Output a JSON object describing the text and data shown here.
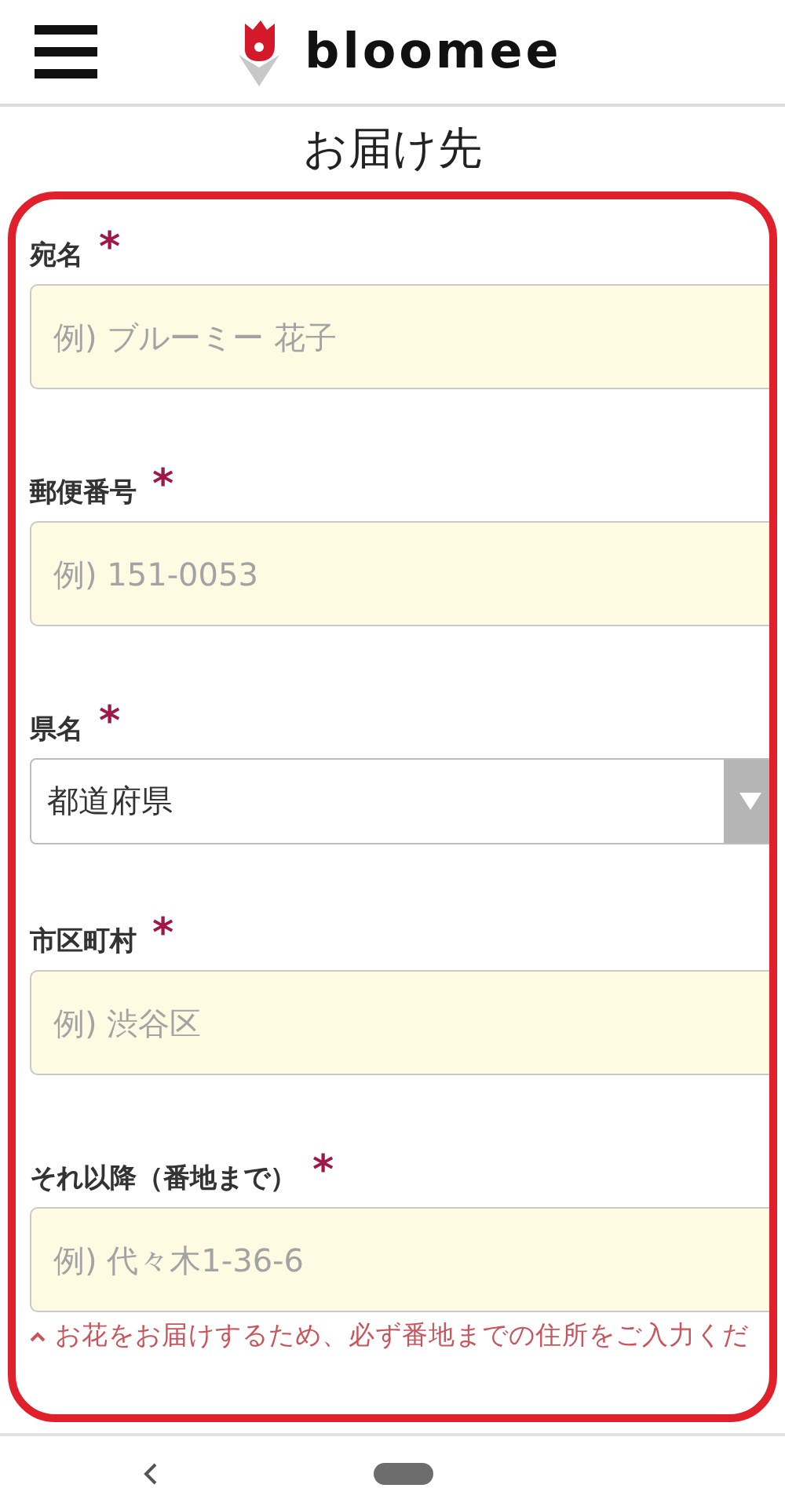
{
  "header": {
    "brand": "bloomee"
  },
  "title": "お届け先",
  "fields": [
    {
      "label": "宛名",
      "required_mark": "*",
      "kind": "text",
      "placeholder": "例) ブルーミー 花子"
    },
    {
      "label": "郵便番号",
      "required_mark": "*",
      "kind": "text",
      "placeholder": "例) 151-0053"
    },
    {
      "label": "県名",
      "required_mark": "*",
      "kind": "select",
      "value": "都道府県"
    },
    {
      "label": "市区町村",
      "required_mark": "*",
      "kind": "text",
      "placeholder": "例) 渋谷区"
    },
    {
      "label": "それ以降（番地まで）",
      "required_mark": "*",
      "kind": "text",
      "placeholder": "例) 代々木1-36-6"
    }
  ],
  "note": "お花をお届けするため、必ず番地までの住所をご入力くだ"
}
